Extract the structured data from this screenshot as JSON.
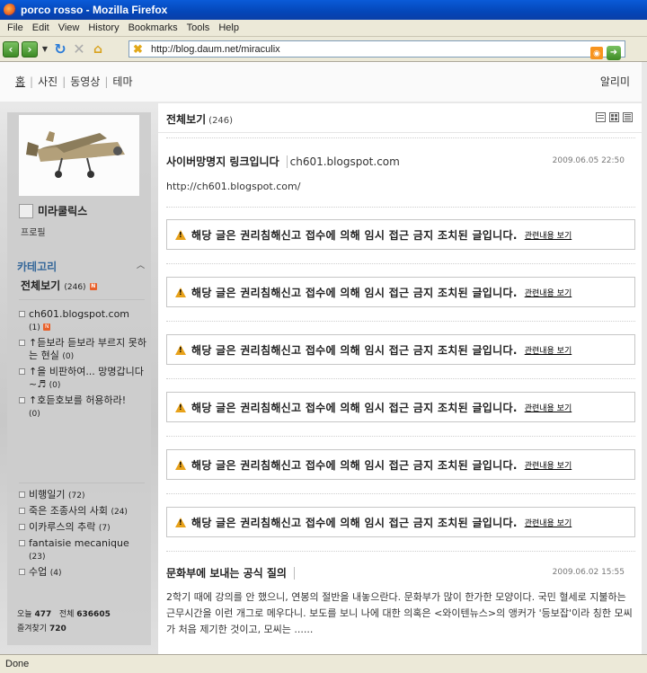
{
  "window": {
    "title": "porco rosso - Mozilla Firefox"
  },
  "menu": [
    "File",
    "Edit",
    "View",
    "History",
    "Bookmarks",
    "Tools",
    "Help"
  ],
  "address": {
    "url": "http://blog.daum.net/miraculix"
  },
  "status": {
    "text": "Done"
  },
  "topnav": {
    "links": [
      "홈",
      "사진",
      "동영상",
      "테마"
    ],
    "notice": "알리미"
  },
  "sidebar": {
    "nickname": "미라쿨릭스",
    "profile_link": "프로필",
    "category_header": "카테고리",
    "all_label": "전체보기",
    "all_count": "(246)",
    "new_mark": "N",
    "groups": [
      [
        {
          "label": "ch601.blogspot.com",
          "count": "(1)",
          "new": true
        },
        {
          "label": "↑듣보라 듣보라 부르지 못하는 현실",
          "count": "(0)",
          "new": false
        },
        {
          "label": "↑을 비판하여... 망명갑니다~♬",
          "count": "(0)",
          "new": false
        },
        {
          "label": "↑호듣호보를 허용하라!",
          "count": "(0)",
          "new": false
        }
      ],
      [
        {
          "label": "비행일기",
          "count": "(72)",
          "new": false
        },
        {
          "label": "죽은 조종사의 사회",
          "count": "(24)",
          "new": false
        },
        {
          "label": "이카루스의 추락",
          "count": "(7)",
          "new": false
        },
        {
          "label": "fantaisie mecanique",
          "count": "(23)",
          "new": false
        },
        {
          "label": "수업",
          "count": "(4)",
          "new": false
        }
      ]
    ],
    "stats": {
      "today_label": "오늘",
      "today": "477",
      "total_label": "전체",
      "total": "636605",
      "fav_label": "즐겨찾기",
      "fav": "720"
    }
  },
  "main": {
    "title": "전체보기",
    "count": "(246)",
    "posts": [
      {
        "title": "사이버망명지 링크입니다",
        "sub": "ch601.blogspot.com",
        "date": "2009.06.05 22:50",
        "body": "http://ch601.blogspot.com/"
      }
    ],
    "blocked_message": "해당 글은 권리침해신고 접수에 의해 임시 접근 금지 조치된 글입니다.",
    "blocked_link": "관련내용 보기",
    "blocked_count": 6,
    "last_post": {
      "title": "문화부에 보내는 공식 질의",
      "date": "2009.06.02 15:55",
      "body": "2학기 때에 강의를 안 했으니, 연봉의 절반을 내놓으란다. 문화부가 많이 한가한 모양이다. 국민 혈세로 지불하는 근무시간을 이런 개그로 메우다니. 보도를 보니 나에 대한 의혹은 <와이텐뉴스>의 앵커가 '등보잡'이라 칭한 모씨가 처음 제기한 것이고, 모씨는 ......"
    }
  }
}
